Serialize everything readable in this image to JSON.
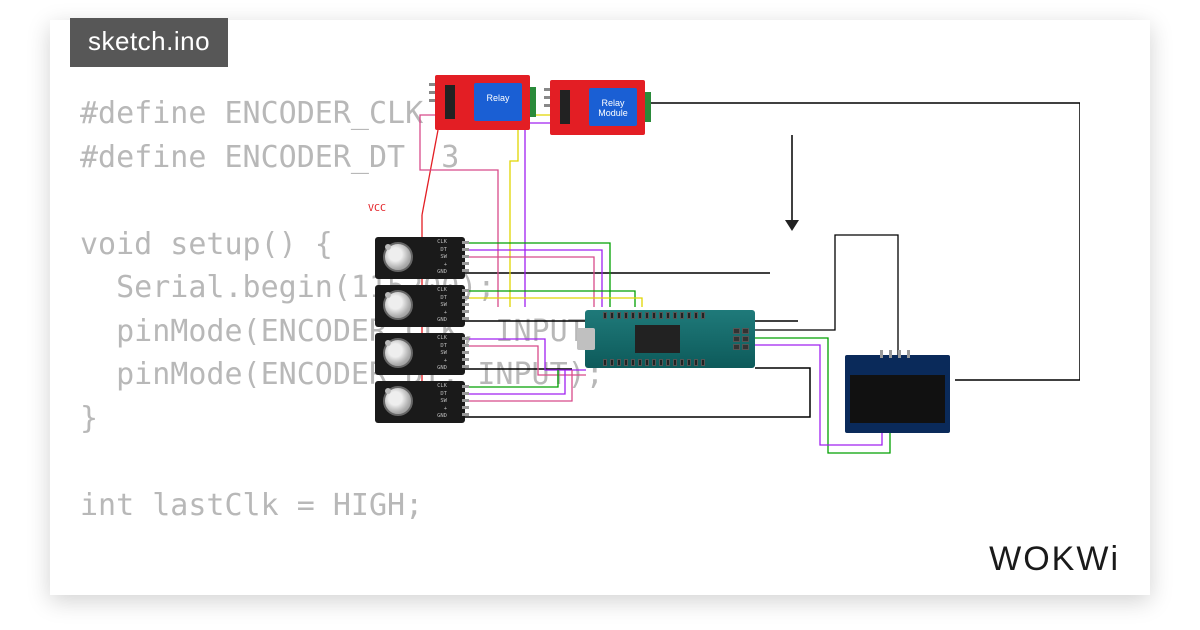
{
  "tab": {
    "filename": "sketch.ino"
  },
  "code": {
    "text": "#define ENCODER_CLK 2\n#define ENCODER_DT  3\n\nvoid setup() {\n  Serial.begin(115200);\n  pinMode(ENCODER_CLK, INPUT);\n  pinMode(ENCODER_DT, INPUT);\n}\n\nint lastClk = HIGH;"
  },
  "brand": "WOKWi",
  "circuit": {
    "vcc_label": "VCC",
    "relay1": {
      "label": "Relay"
    },
    "relay2": {
      "label": "Relay\nModule"
    },
    "encoder_pin_labels": "CLK\nDT\nSW\n+\nGND",
    "components": {
      "relays": 2,
      "rotary_encoders": 4,
      "microcontroller": "Arduino Nano",
      "display": "OLED SSD1306"
    }
  }
}
